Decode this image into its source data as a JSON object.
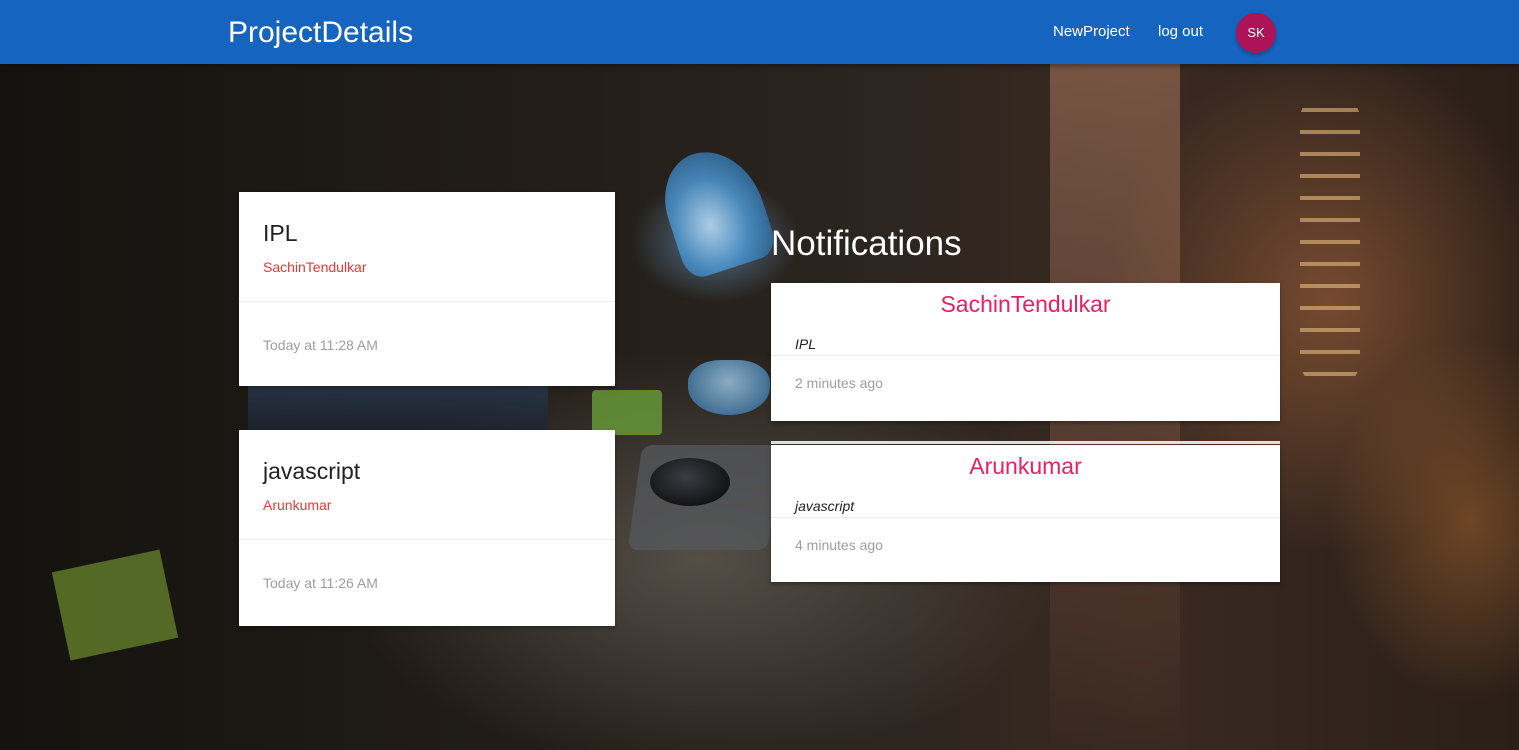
{
  "header": {
    "brand": "ProjectDetails",
    "nav": {
      "new_project": "NewProject",
      "log_out": "log out"
    },
    "avatar_initials": "SK",
    "colors": {
      "bar": "#1565c0",
      "avatar": "#ad1457"
    }
  },
  "projects": [
    {
      "title": "IPL",
      "author": "SachinTendulkar",
      "created": "Today at 11:28 AM"
    },
    {
      "title": "javascript",
      "author": "Arunkumar",
      "created": "Today at 11:26 AM"
    }
  ],
  "notifications": {
    "heading": "Notifications",
    "items": [
      {
        "user": "SachinTendulkar",
        "project": "IPL",
        "time": "2 minutes ago"
      },
      {
        "user": "Arunkumar",
        "project": "javascript",
        "time": "4 minutes ago"
      }
    ]
  },
  "colors": {
    "author_text": "#e53935",
    "notification_user": "#e91e63"
  }
}
